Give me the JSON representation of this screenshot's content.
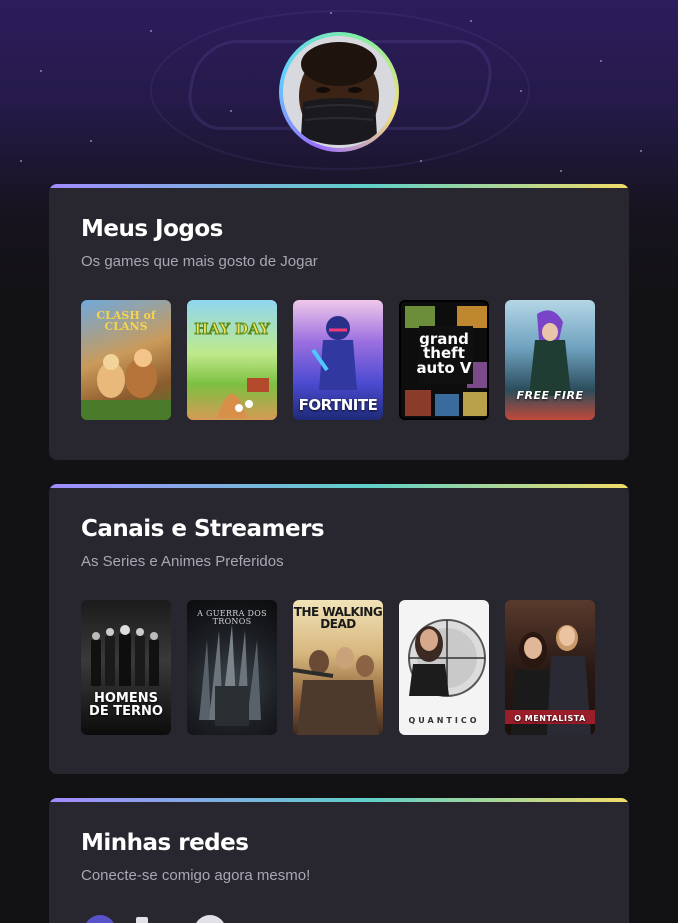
{
  "profile": {
    "avatar_alt": "Foto de perfil"
  },
  "games_section": {
    "title": "Meus Jogos",
    "subtitle": "Os games que mais gosto de Jogar",
    "items": [
      {
        "label": "CLASH of CLANS",
        "icon": "clash-of-clans-cover"
      },
      {
        "label": "HAY DAY",
        "icon": "hay-day-cover"
      },
      {
        "label": "FORTNITE",
        "icon": "fortnite-cover"
      },
      {
        "label": "grand theft auto V",
        "icon": "gta-v-cover"
      },
      {
        "label": "FREE FIRE",
        "icon": "free-fire-cover"
      }
    ]
  },
  "series_section": {
    "title": "Canais e Streamers",
    "subtitle": "As Series e Animes Preferidos",
    "items": [
      {
        "label": "HOMENS DE TERNO",
        "icon": "homens-de-terno-cover"
      },
      {
        "label": "A GUERRA DOS TRONOS",
        "icon": "guerra-dos-tronos-cover"
      },
      {
        "label": "THE WALKING DEAD",
        "icon": "walking-dead-cover"
      },
      {
        "label": "QUANTICO",
        "icon": "quantico-cover"
      },
      {
        "label": "O MENTALISTA",
        "icon": "mentalista-cover"
      }
    ]
  },
  "social_section": {
    "title": "Minhas redes",
    "subtitle": "Conecte-se comigo agora mesmo!"
  },
  "colors": {
    "background": "#121214",
    "card": "#28262f",
    "title": "#ffffff",
    "subtitle": "#a8a8b3",
    "gradient_start": "#a28bff",
    "gradient_mid": "#5fd0c8",
    "gradient_end": "#f2dc68"
  }
}
